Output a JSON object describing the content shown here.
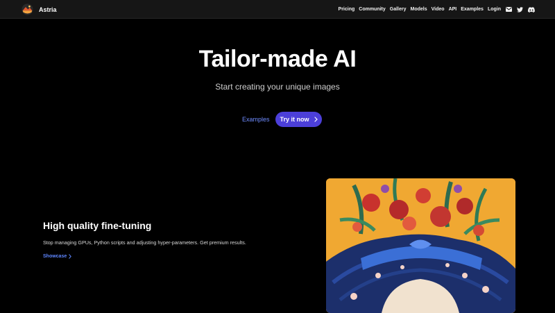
{
  "brand": {
    "name": "Astria",
    "logo_icon": "astria-logo-icon"
  },
  "nav": {
    "links": [
      "Pricing",
      "Community",
      "Gallery",
      "Models",
      "Video",
      "API",
      "Examples",
      "Login"
    ],
    "icons": [
      "mail-icon",
      "twitter-icon",
      "discord-icon"
    ]
  },
  "hero": {
    "title": "Tailor-made AI",
    "subtitle": "Start creating your unique images",
    "examples_label": "Examples",
    "cta_label": "Try it now"
  },
  "feature": {
    "title": "High quality fine-tuning",
    "description": "Stop managing GPUs, Python scripts and adjusting hyper-parameters. Get premium results.",
    "link_label": "Showcase"
  },
  "colors": {
    "background": "#000000",
    "nav_background": "#161616",
    "accent": "#4c3fd9",
    "link": "#6f8cff",
    "artwork_background": "#f0a832"
  }
}
